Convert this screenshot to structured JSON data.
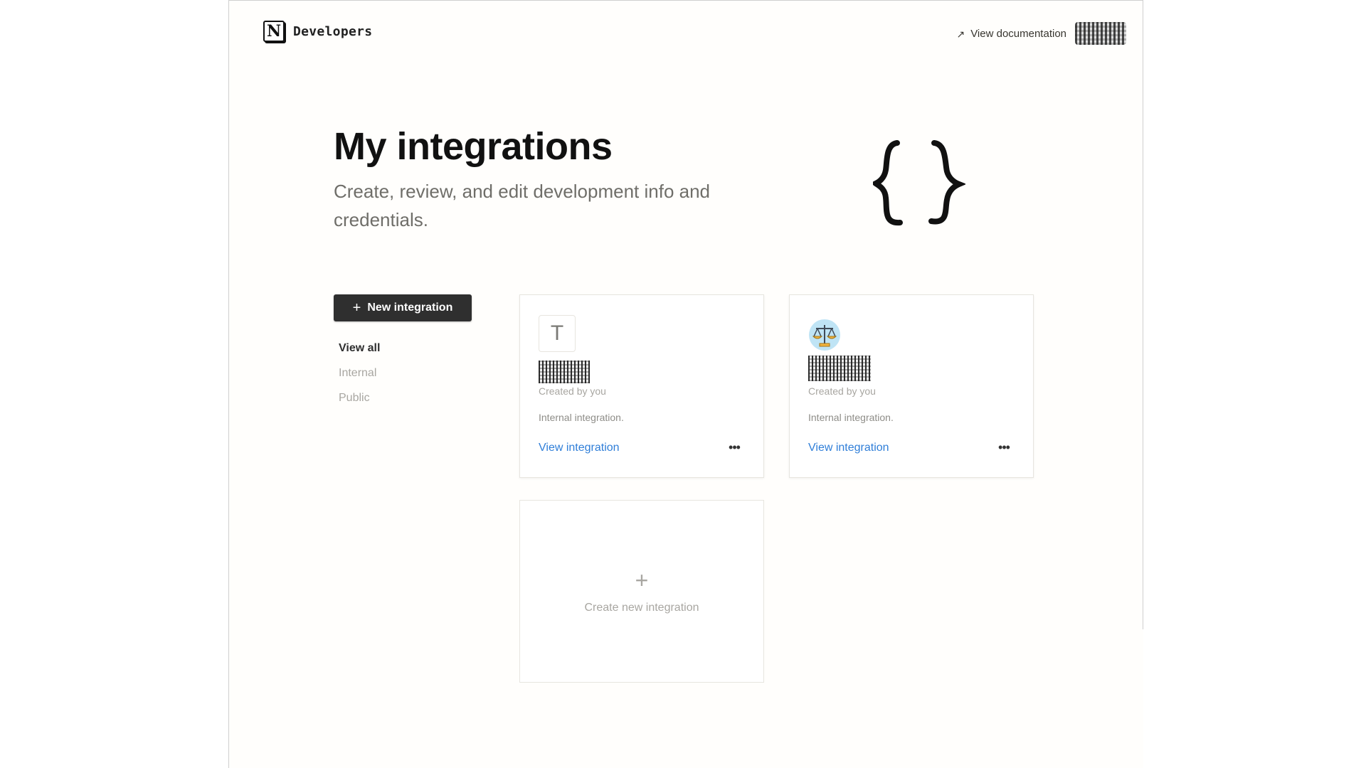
{
  "header": {
    "brand": "Developers",
    "doc_link": "View documentation",
    "user_avatar": "redacted-avatar"
  },
  "hero": {
    "title": "My integrations",
    "subtitle": "Create, review, and edit development info and credentials.",
    "illustration_icon": "curly-braces-icon"
  },
  "actions": {
    "new_integration": "New integration"
  },
  "filters": {
    "items": [
      {
        "label": "View all",
        "active": true
      },
      {
        "label": "Internal",
        "active": false
      },
      {
        "label": "Public",
        "active": false
      }
    ]
  },
  "integrations": [
    {
      "icon_text": "T",
      "icon_name": "letter-t-icon",
      "name": "redacted",
      "created_by": "Created by you",
      "type": "Internal integration.",
      "view_label": "View integration",
      "more_label": "•••"
    },
    {
      "icon_text": "",
      "icon_name": "scale-icon",
      "name": "redacted",
      "created_by": "Created by you",
      "type": "Internal integration.",
      "view_label": "View integration",
      "more_label": "•••"
    }
  ],
  "create_card": {
    "plus": "+",
    "label": "Create new integration"
  },
  "colors": {
    "primary_button": "#2f2f2f",
    "link": "#2f7ed8",
    "muted_text": "#a8a6a1",
    "card_border": "#e7e5df"
  }
}
